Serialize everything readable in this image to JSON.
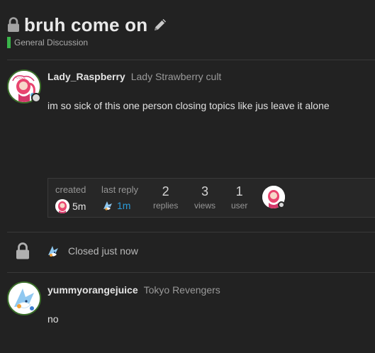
{
  "topic": {
    "title": "bruh come on",
    "category": "General Discussion",
    "category_color": "#3ab54a"
  },
  "post1": {
    "username": "Lady_Raspberry",
    "user_title": "Lady Strawberry cult",
    "body": "im so sick of this one person closing topics like jus leave it alone"
  },
  "topic_map": {
    "created_label": "created",
    "created_value": "5m",
    "last_reply_label": "last reply",
    "last_reply_value": "1m",
    "replies_count": "2",
    "replies_label": "replies",
    "views_count": "3",
    "views_label": "views",
    "users_count": "1",
    "users_label": "user"
  },
  "small_action": {
    "text": "Closed just now"
  },
  "post2": {
    "username": "yummyorangejuice",
    "user_title": "Tokyo Revengers",
    "body": "no"
  }
}
